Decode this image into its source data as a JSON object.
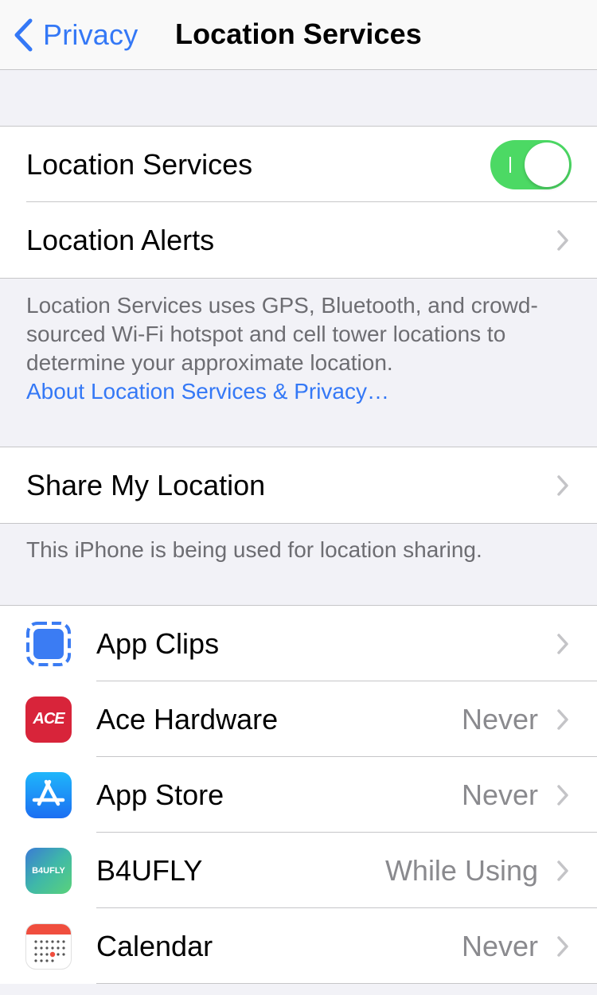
{
  "nav": {
    "back_label": "Privacy",
    "title": "Location Services"
  },
  "location_services": {
    "label": "Location Services",
    "enabled": true,
    "accent_color": "#4cd964"
  },
  "location_alerts": {
    "label": "Location Alerts"
  },
  "description": {
    "text": "Location Services uses GPS, Bluetooth, and crowd-sourced Wi-Fi hotspot and cell tower locations to determine your approximate location.",
    "link": "About Location Services & Privacy…"
  },
  "share": {
    "label": "Share My Location",
    "footer": "This iPhone is being used for location sharing."
  },
  "apps": [
    {
      "name": "App Clips",
      "value": "",
      "icon": "app-clips-icon"
    },
    {
      "name": "Ace Hardware",
      "value": "Never",
      "icon": "ace-hardware-icon",
      "icon_text": "ACE"
    },
    {
      "name": "App Store",
      "value": "Never",
      "icon": "app-store-icon"
    },
    {
      "name": "B4UFLY",
      "value": "While Using",
      "icon": "b4ufly-icon",
      "icon_text": "B4UFLY"
    },
    {
      "name": "Calendar",
      "value": "Never",
      "icon": "calendar-icon"
    }
  ],
  "colors": {
    "link_blue": "#3478f6",
    "secondary_text": "#8a8a8e",
    "background": "#f2f2f7"
  }
}
